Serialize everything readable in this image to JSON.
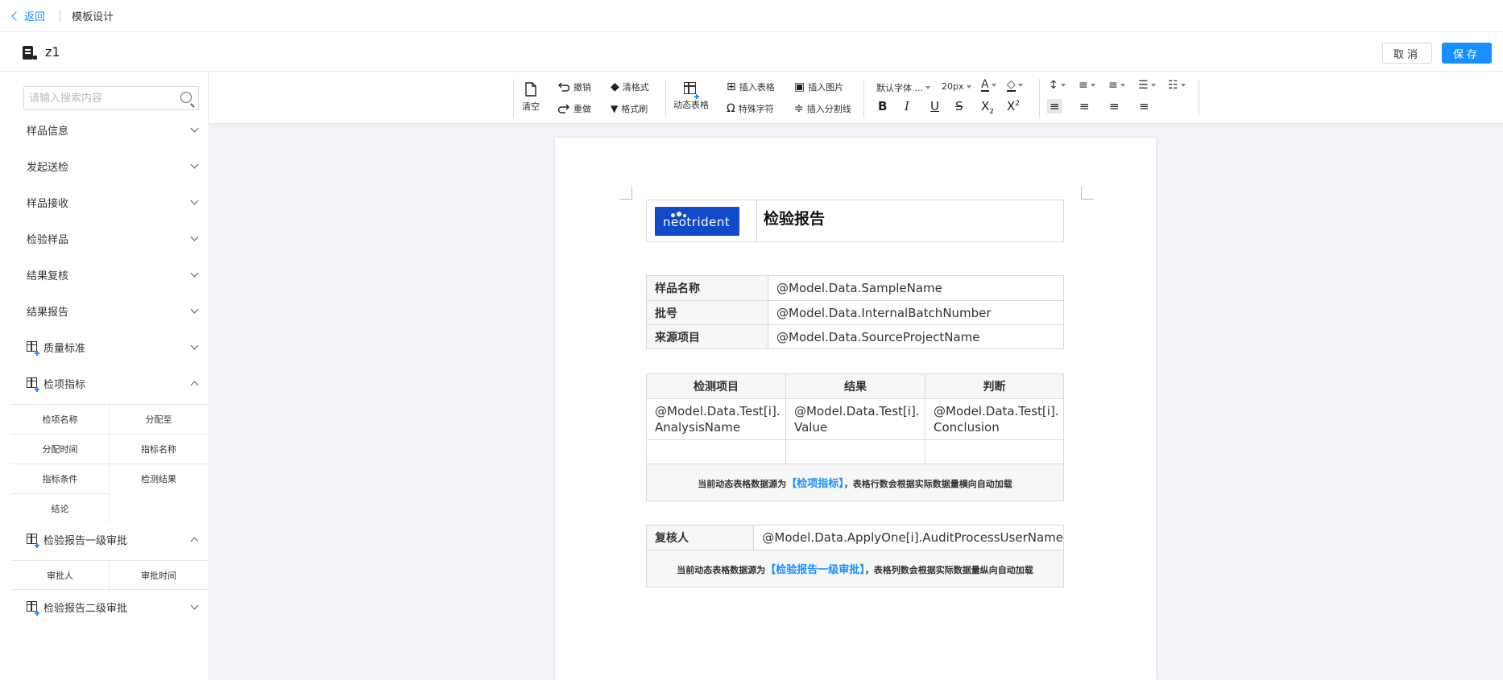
{
  "topbar": {
    "back_label": "返回",
    "breadcrumb": "模板设计"
  },
  "titlebar": {
    "template_name": "z1",
    "cancel_label": "取消",
    "save_label": "保存"
  },
  "sidebar": {
    "search_placeholder": "请输入搜索内容",
    "groups": [
      {
        "label": "样品信息",
        "expanded": false
      },
      {
        "label": "发起送检",
        "expanded": false
      },
      {
        "label": "样品接收",
        "expanded": false
      },
      {
        "label": "检验样品",
        "expanded": false
      },
      {
        "label": "结果复核",
        "expanded": false
      },
      {
        "label": "结果报告",
        "expanded": false
      },
      {
        "label": "质量标准",
        "expanded": false,
        "icon": "dynamic-table-icon"
      },
      {
        "label": "检项指标",
        "expanded": true,
        "icon": "dynamic-table-icon",
        "fields": [
          "检项名称",
          "分配至",
          "分配时间",
          "指标名称",
          "指标条件",
          "检测结果",
          "结论"
        ]
      },
      {
        "label": "检验报告一级审批",
        "expanded": true,
        "icon": "dynamic-table-icon",
        "fields": [
          "审批人",
          "审批时间"
        ]
      },
      {
        "label": "检验报告二级审批",
        "expanded": false,
        "icon": "dynamic-table-icon"
      }
    ]
  },
  "toolbar": {
    "clear": "清空",
    "undo": "撤销",
    "redo": "重做",
    "clear_format": "清格式",
    "format_painter": "格式刷",
    "dynamic_table": "动态表格",
    "insert_table": "插入表格",
    "special_char": "特殊字符",
    "insert_image": "插入图片",
    "insert_divider": "插入分割线",
    "font_family": "默认字体 ...",
    "font_size": "20px"
  },
  "document": {
    "header_title": "检验报告",
    "logo_text": "neotrident",
    "info_rows": [
      {
        "label": "样品名称",
        "value": "@Model.Data.SampleName"
      },
      {
        "label": "批号",
        "value": "@Model.Data.InternalBatchNumber"
      },
      {
        "label": "来源项目",
        "value": "@Model.Data.SourceProjectName"
      }
    ],
    "test_table": {
      "headers": [
        "检测项目",
        "结果",
        "判断"
      ],
      "row": [
        "@Model.Data.Test[i].",
        "@Model.Data.Test[i].",
        "@Model.Data.Test[i]."
      ],
      "row2": [
        "AnalysisName",
        "Value",
        "Conclusion"
      ],
      "note_prefix": "当前动态表格数据源为",
      "note_source": "【检项指标】",
      "note_suffix": "，表格行数会根据实际数据量横向自动加载"
    },
    "review_table": {
      "label": "复核人",
      "value": "@Model.Data.ApplyOne[i].AuditProcessUserName",
      "note_prefix": "当前动态表格数据源为",
      "note_source": "【检验报告一级审批】",
      "note_suffix": "，表格列数会根据实际数据量纵向自动加载"
    }
  }
}
